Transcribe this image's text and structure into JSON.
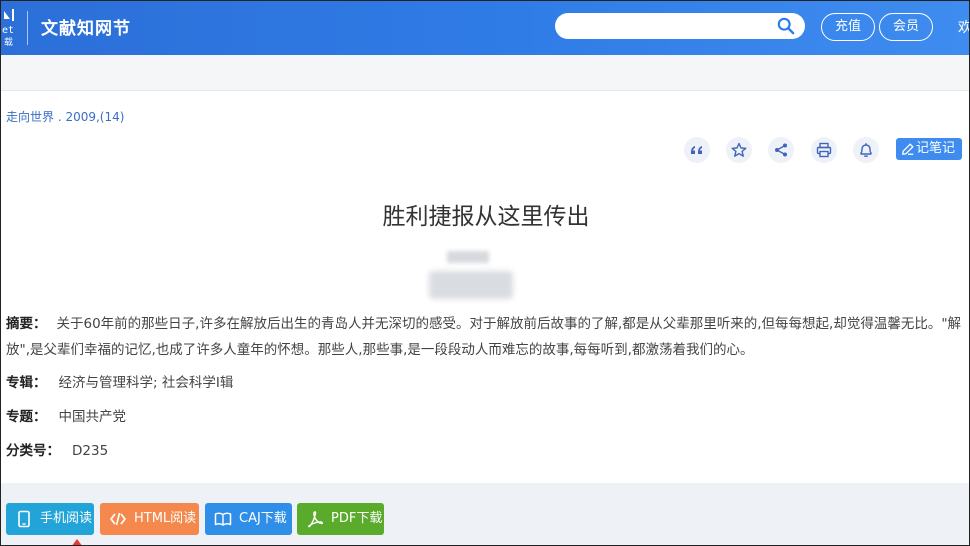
{
  "header": {
    "logo_mark": "cnki",
    "logo_text": "ct\n载",
    "site_title": "文献知网节",
    "search_placeholder": "",
    "recharge_label": "充值",
    "member_label": "会员",
    "cut_text": "欢"
  },
  "article": {
    "source": "走向世界 . 2009,(14)",
    "title": "胜利捷报从这里传出",
    "abstract_label": "摘要：",
    "abstract_text": "关于60年前的那些日子,许多在解放后出生的青岛人并无深切的感受。对于解放前后故事的了解,都是从父辈那里听来的,但每每想起,却觉得温馨无比。\"解放\",是父辈们幸福的记忆,也成了许多人童年的怀想。那些人,那些事,是一段段动人而难忘的故事,每每听到,都激荡着我们的心。",
    "topic_label": "专辑：",
    "topic_value": "经济与管理科学; 社会科学Ⅰ辑",
    "subject_label": "专题：",
    "subject_value": "中国共产党",
    "class_label": "分类号：",
    "class_value": "D235"
  },
  "toolbar": {
    "icons": [
      "quote-icon",
      "star-icon",
      "share-icon",
      "print-icon",
      "bell-icon"
    ],
    "notes_label": "记笔记"
  },
  "downloads": {
    "phone_label": "手机阅读",
    "html_label": "HTML阅读",
    "caj_label": "CAJ下载",
    "pdf_label": "PDF下载"
  },
  "colors": {
    "header_blue": "#2f7be6",
    "accent_blue": "#3f8cf0",
    "phone": "#23a4d9",
    "html": "#f5884d",
    "caj": "#2f8ee8",
    "pdf": "#5aaa2c"
  }
}
